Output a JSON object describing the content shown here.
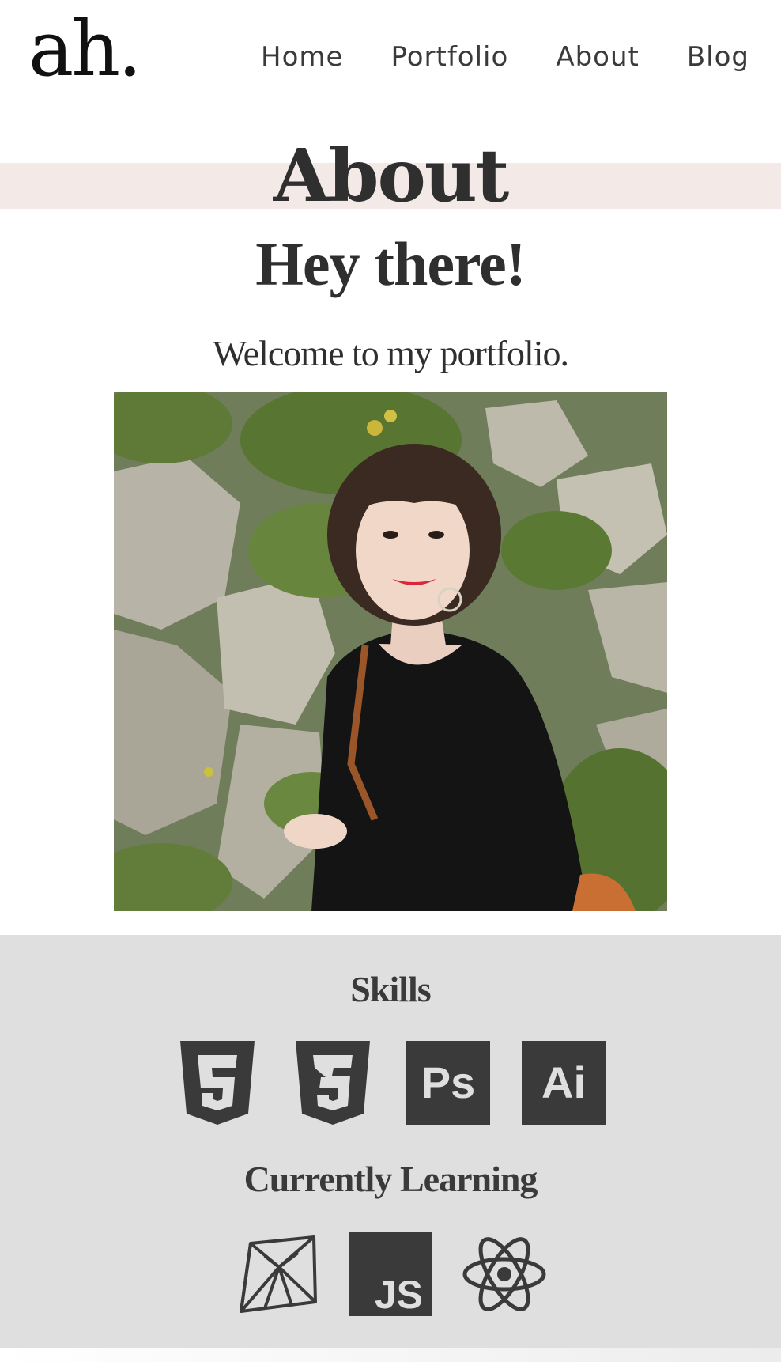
{
  "header": {
    "logo": "ah.",
    "nav": [
      "Home",
      "Portfolio",
      "About",
      "Blog"
    ]
  },
  "page": {
    "title": "About",
    "greeting": "Hey there!",
    "welcome": "Welcome to my portfolio."
  },
  "skills": {
    "heading": "Skills",
    "icons": [
      "html5-icon",
      "css3-icon",
      "photoshop-icon",
      "illustrator-icon"
    ],
    "ps_label": "Ps",
    "ai_label": "Ai"
  },
  "learning": {
    "heading": "Currently Learning",
    "icons": [
      "ruby-icon",
      "javascript-icon",
      "react-icon"
    ],
    "js_label": "JS"
  },
  "colors": {
    "text": "#2f2f2f",
    "title_band": "#f3e9e7",
    "skills_bg": "#dfdfdf",
    "icon_fill": "#3a3a3a"
  }
}
